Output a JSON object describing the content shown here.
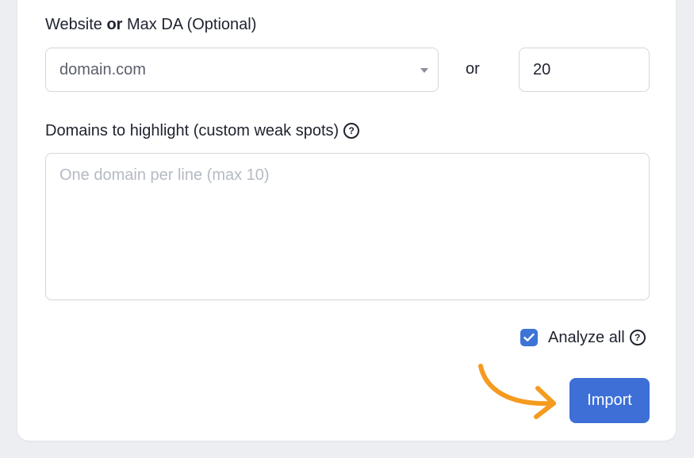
{
  "form": {
    "website_label_prefix": "Website ",
    "website_label_bold": "or",
    "website_label_suffix": " Max DA (Optional)",
    "website_select_value": "domain.com",
    "or_text": "or",
    "max_da_value": "20",
    "highlight_label": "Domains to highlight (custom weak spots)",
    "highlight_placeholder": "One domain per line (max 10)",
    "analyze_all_label": "Analyze all",
    "analyze_all_checked": true,
    "import_button": "Import"
  },
  "icons": {
    "help": "question-circle-icon",
    "caret": "chevron-down-icon",
    "check": "check-icon",
    "arrow": "curved-arrow-annotation"
  },
  "colors": {
    "accent": "#3d6fd6",
    "arrow": "#f49b1f",
    "border": "#d3d6dc",
    "placeholder": "#b5bac3"
  }
}
